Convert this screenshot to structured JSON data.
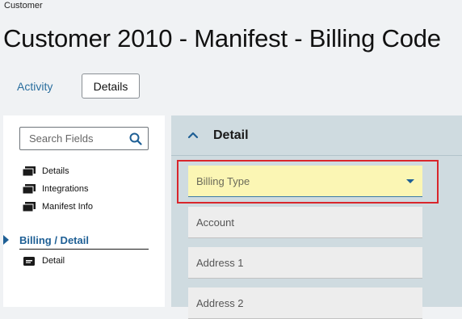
{
  "breadcrumb": "Customer",
  "page_title": "Customer 2010 - Manifest - Billing Code",
  "tabs": {
    "activity": "Activity",
    "details": "Details"
  },
  "sidebar": {
    "search_placeholder": "Search Fields",
    "items": [
      {
        "label": "Details",
        "icon": "stack-icon"
      },
      {
        "label": "Integrations",
        "icon": "stack-icon"
      },
      {
        "label": "Manifest Info",
        "icon": "stack-icon"
      }
    ],
    "section": {
      "label": "Billing / Detail",
      "items": [
        {
          "label": "Detail",
          "icon": "card-icon"
        }
      ]
    }
  },
  "main": {
    "panel_title": "Detail",
    "fields": [
      {
        "label": "Billing Type",
        "type": "dropdown",
        "highlighted": true
      },
      {
        "label": "Account",
        "type": "text"
      },
      {
        "label": "Address 1",
        "type": "text"
      },
      {
        "label": "Address 2",
        "type": "text"
      }
    ]
  },
  "colors": {
    "accent": "#1e5f95",
    "panel_bg": "#cfdbe0",
    "highlight_field": "#fbf6b4",
    "highlight_border": "#d9262c"
  }
}
